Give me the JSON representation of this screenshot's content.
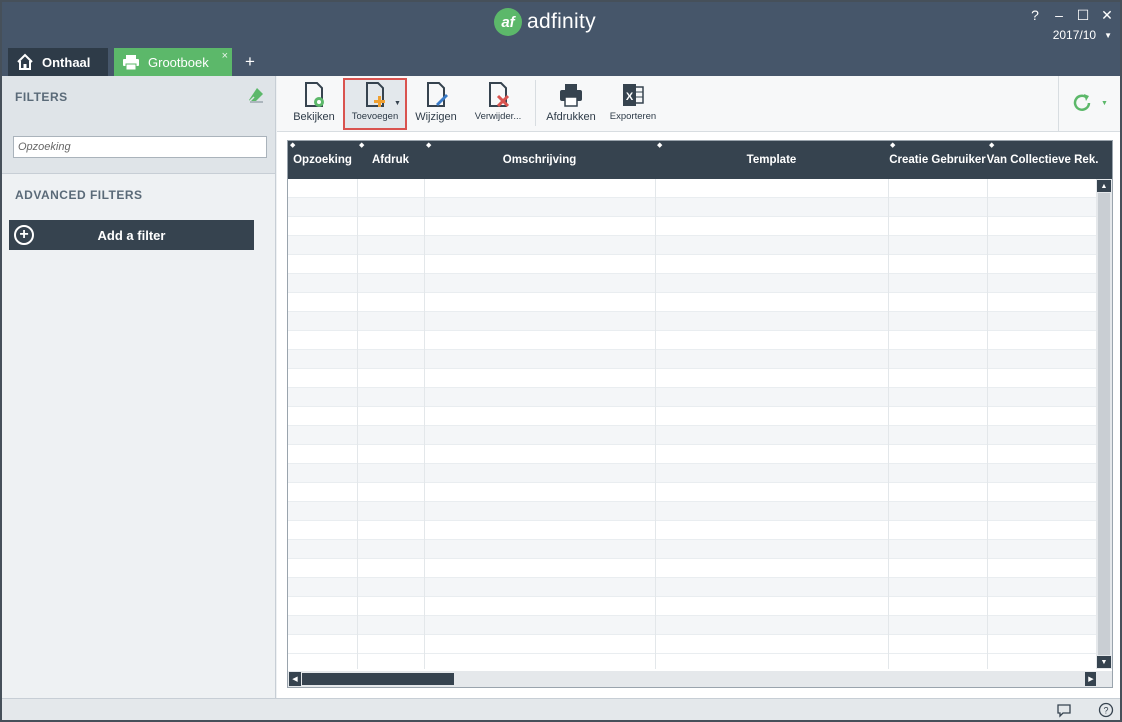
{
  "app": {
    "name": "adfinity",
    "logo_mark": "af",
    "period": "2017/10",
    "window_controls": {
      "help": "?",
      "minimize": "–",
      "maximize": "☐",
      "close": "✕"
    }
  },
  "tabs": [
    {
      "label": "Onthaal",
      "icon": "home-icon"
    },
    {
      "label": "Grootboek",
      "icon": "printer-icon",
      "close": "×"
    }
  ],
  "tab_add": "+",
  "sidebar": {
    "filters_title": "FILTERS",
    "search_placeholder": "Opzoeking",
    "advanced_title": "ADVANCED FILTERS",
    "add_filter_label": "Add a filter"
  },
  "toolbar": {
    "buttons": [
      {
        "label": "Bekijken",
        "icon": "view-document-icon"
      },
      {
        "label": "Toevoegen",
        "icon": "add-document-icon",
        "highlighted": true
      },
      {
        "label": "Wijzigen",
        "icon": "edit-document-icon"
      },
      {
        "label": "Verwijder...",
        "icon": "delete-document-icon"
      },
      {
        "label": "Afdrukken",
        "icon": "printer-icon"
      },
      {
        "label": "Exporteren",
        "icon": "excel-icon"
      }
    ],
    "refresh_icon": "refresh-icon"
  },
  "grid": {
    "columns": [
      "Opzoeking",
      "Afdruk",
      "Omschrijving",
      "Template",
      "Creatie Gebruiker",
      "Van Collectieve Rek."
    ],
    "rows": []
  },
  "colors": {
    "titlebar": "#46566a",
    "accent_green": "#5cb86a",
    "dark_header": "#36434f",
    "highlight_border": "#d9534f"
  }
}
